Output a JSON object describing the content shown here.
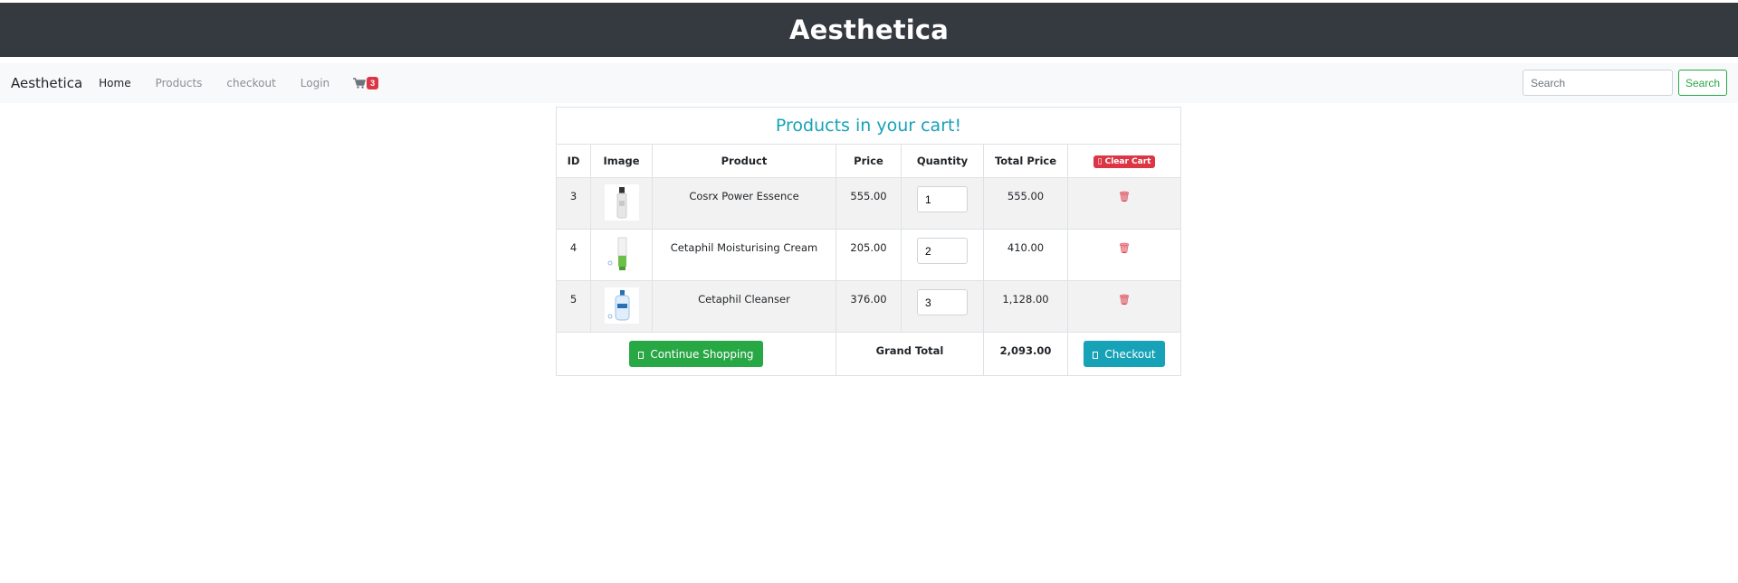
{
  "header": {
    "title": "Aesthetica"
  },
  "nav": {
    "brand": "Aesthetica",
    "links": [
      "Home",
      "Products",
      "checkout",
      "Login"
    ],
    "cart_count": "3",
    "search": {
      "placeholder": "Search",
      "button": "Search"
    }
  },
  "cart": {
    "caption": "Products in your cart!",
    "columns": [
      "ID",
      "Image",
      "Product",
      "Price",
      "Quantity",
      "Total Price"
    ],
    "clear_label": "Clear Cart",
    "rows": [
      {
        "id": "3",
        "image": "serum-bottle-image",
        "product": "Cosrx Power Essence",
        "price": "555.00",
        "quantity": "1",
        "total": "555.00"
      },
      {
        "id": "4",
        "image": "cream-tube-image",
        "product": "Cetaphil Moisturising Cream",
        "price": "205.00",
        "quantity": "2",
        "total": "410.00"
      },
      {
        "id": "5",
        "image": "cleanser-bottle-image",
        "product": "Cetaphil Cleanser",
        "price": "376.00",
        "quantity": "3",
        "total": "1,128.00"
      }
    ],
    "continue_label": "Continue Shopping",
    "grand_total_label": "Grand Total",
    "grand_total": "2,093.00",
    "checkout_label": "Checkout"
  },
  "colors": {
    "header_bg": "#343a40",
    "accent_info": "#17a2b8",
    "danger": "#dc3545",
    "success": "#28a745"
  }
}
